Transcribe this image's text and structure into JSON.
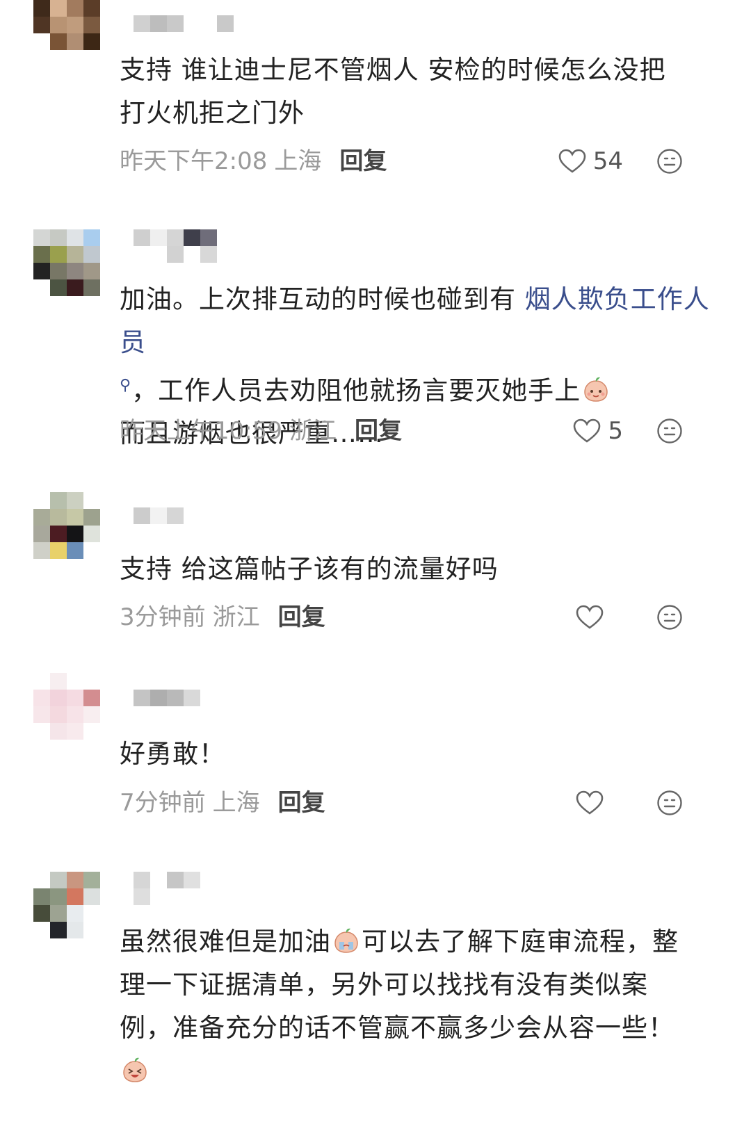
{
  "comments": [
    {
      "text": [
        "支持 谁让迪士尼不管烟人 安检的时候怎么没把",
        "打火机拒之门外"
      ],
      "time": "昨天下午2:08",
      "location": "上海",
      "reply_label": "回复",
      "likes": "54",
      "avatar_colors": [
        "#4e3422",
        "#c9a383",
        "#a17e62",
        "#6b4a33",
        "#4a3320",
        "#b99a80",
        "#9d8068",
        "#ffffff",
        "#ffffff",
        "#7a5538",
        "#5a3a22",
        "#ffffff",
        "#ffffff",
        "#ffffff",
        "#ffffff",
        "#ffffff"
      ]
    },
    {
      "text_parts": [
        "加油。上次排互动的时候也碰到有 ",
        "烟人欺负工作人员",
        "，工作人员去劝阻他就扬言要灭她手上",
        "而且游烟也很严重……"
      ],
      "time": "昨天上午10:59",
      "location": "浙江",
      "reply_label": "回复",
      "likes": "5"
    },
    {
      "text": [
        "支持 给这篇帖子该有的流量好吗"
      ],
      "time": "3分钟前",
      "location": "浙江",
      "reply_label": "回复",
      "likes": ""
    },
    {
      "text": [
        "好勇敢！"
      ],
      "time": "7分钟前",
      "location": "上海",
      "reply_label": "回复",
      "likes": ""
    },
    {
      "text": [
        "虽然很难但是加油",
        "可以去了解下庭审流程，整",
        "理一下证据清单，另外可以找找有没有类似案",
        "例，准备充分的话不管赢不赢多少会从容一些！"
      ]
    }
  ],
  "icons": {
    "like": "heart-outline-icon",
    "react": "emoji-face-icon"
  },
  "colors": {
    "link": "#3a4e8c",
    "meta": "#9a9a9a",
    "text": "#222222"
  }
}
